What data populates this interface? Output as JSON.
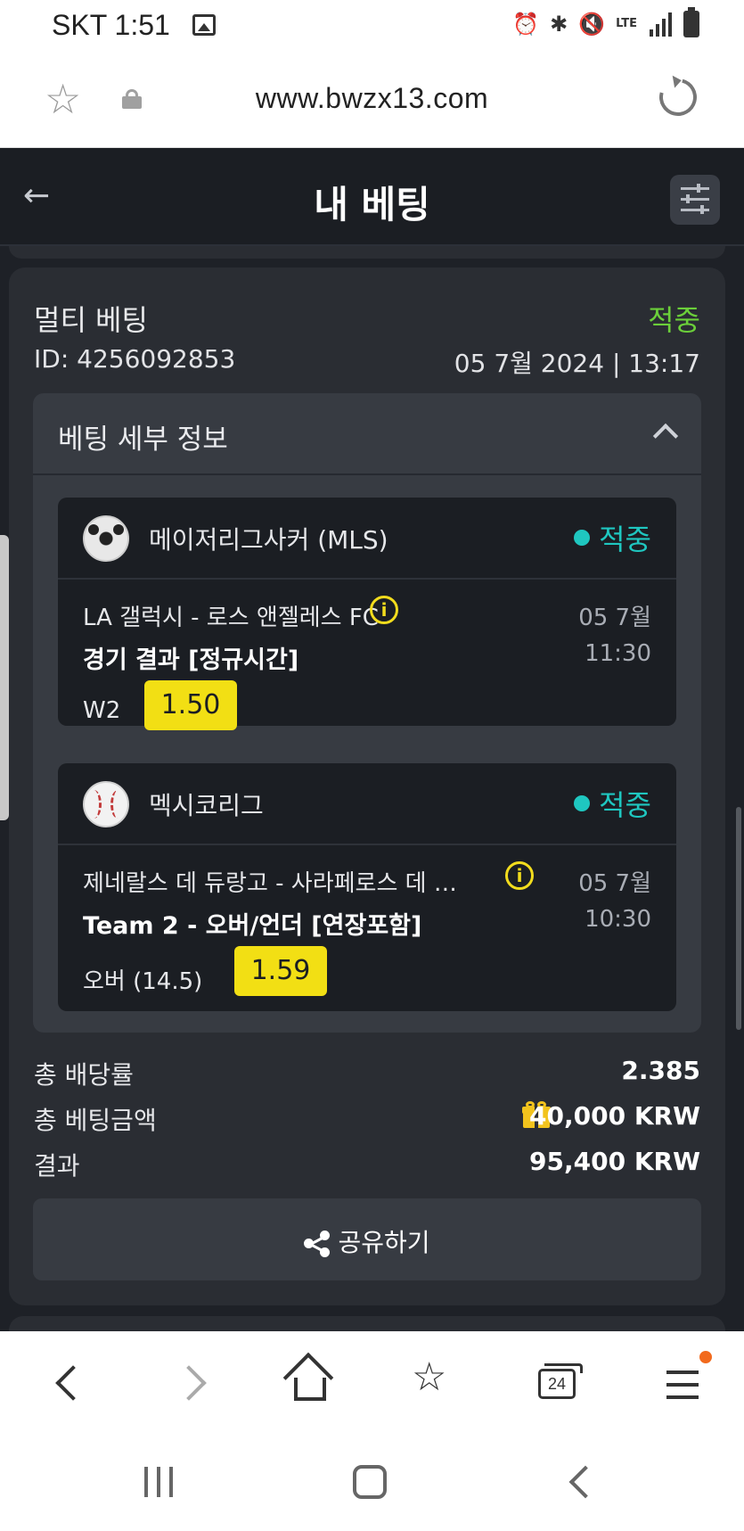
{
  "status_bar": {
    "carrier_time": "SKT 1:51",
    "network": "LTE"
  },
  "browser": {
    "url": "www.bwzx13.com"
  },
  "header": {
    "title": "내 베팅"
  },
  "bet": {
    "type_label": "멀티 베팅",
    "status": "적중",
    "id_text": "ID: 4256092853",
    "datetime": "05 7월 2024 | 13:17",
    "details_title": "베팅 세부 정보",
    "events": [
      {
        "league": "메이저리그사커 (MLS)",
        "sport_icon": "soccer-ball-icon",
        "status": "적중",
        "match": "LA 갤럭시 - 로스 앤젤레스 FC",
        "market": "경기 결과 [정규시간]",
        "selection": "W2",
        "odds": "1.50",
        "date": "05 7월",
        "time": "11:30"
      },
      {
        "league": "멕시코리그",
        "sport_icon": "baseball-icon",
        "status": "적중",
        "match": "제네랄스 데 듀랑고 - 사라페로스 데 …",
        "market": "Team 2 - 오버/언더 [연장포함]",
        "selection": "오버 (14.5)",
        "odds": "1.59",
        "date": "05 7월",
        "time": "10:30"
      }
    ],
    "summary": {
      "total_odds_label": "총 배당률",
      "total_odds": "2.385",
      "total_stake_label": "총 베팅금액",
      "total_stake": "40,000 KRW",
      "result_label": "결과",
      "result": "95,400 KRW"
    },
    "share_label": "공유하기"
  },
  "bottom_nav": {
    "tabs_count": "24"
  },
  "colors": {
    "win_green": "#6bcf3a",
    "win_teal": "#1fc7c0",
    "odds_yellow": "#f2df14",
    "card_bg": "#2a2d33"
  }
}
